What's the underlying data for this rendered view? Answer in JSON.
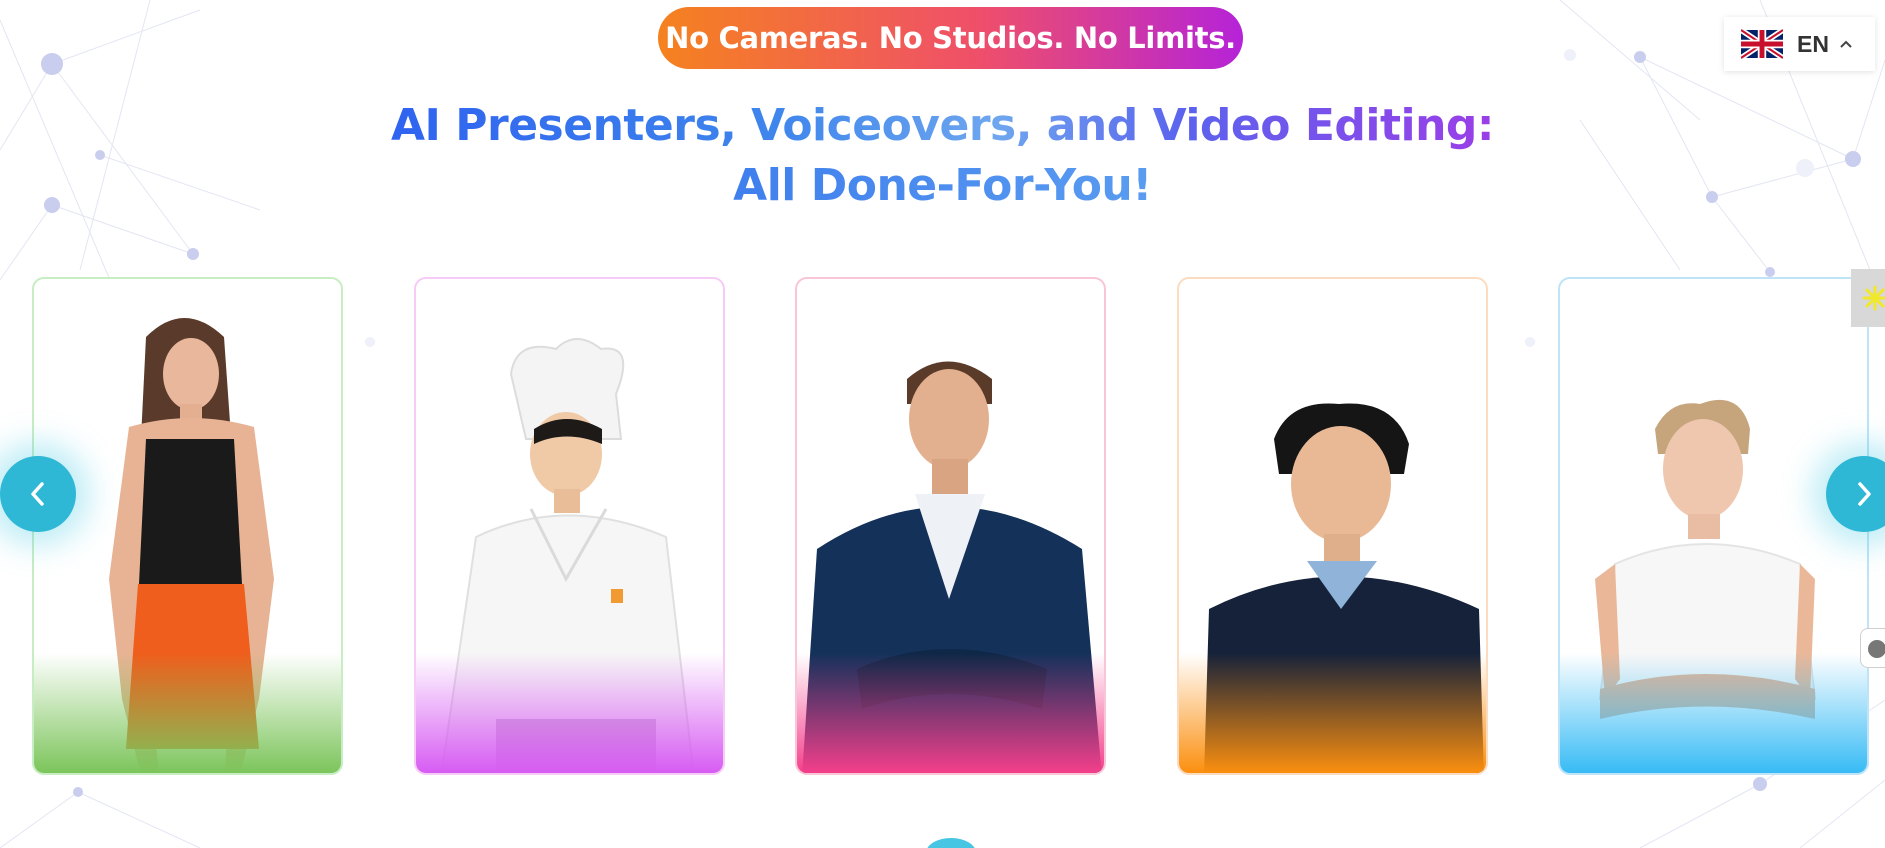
{
  "badge": {
    "text": "No Cameras. No Studios. No Limits."
  },
  "headline": {
    "line1": "AI Presenters, Voiceovers, and Video Editing:",
    "line2": "All Done-For-You!"
  },
  "language": {
    "code": "EN",
    "flag_icon": "uk-flag-icon",
    "chevron_icon": "chevron-up-icon"
  },
  "carousel": {
    "prev_icon": "chevron-left-icon",
    "next_icon": "chevron-right-icon",
    "cards": [
      {
        "name": "presenter-woman-orange-skirt",
        "accent": "#7cc55b"
      },
      {
        "name": "presenter-chef",
        "accent": "#d75cf3"
      },
      {
        "name": "presenter-man-navy-blazer",
        "accent": "#f43f8b"
      },
      {
        "name": "presenter-man-sweater",
        "accent": "#fb8f0f"
      },
      {
        "name": "presenter-woman-white-blouse",
        "accent": "#37bbf5"
      }
    ]
  },
  "colors": {
    "badge_gradient": [
      "#f5821f",
      "#ef4f6a",
      "#b523d8"
    ],
    "headline_blue": "#2f63f0",
    "headline_purple": "#9b3ee8",
    "arrow": "#2fb7d6"
  }
}
